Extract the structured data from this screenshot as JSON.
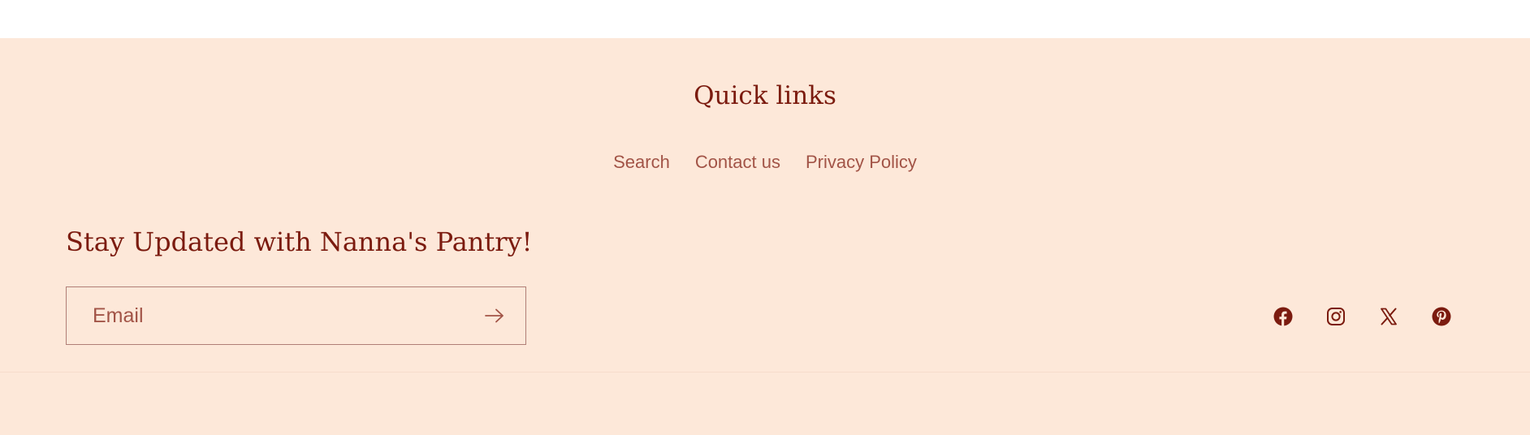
{
  "quick_links": {
    "title": "Quick links",
    "items": [
      {
        "label": "Search"
      },
      {
        "label": "Contact us"
      },
      {
        "label": "Privacy Policy"
      }
    ]
  },
  "newsletter": {
    "title": "Stay Updated with Nanna's Pantry!",
    "email_placeholder": "Email",
    "email_value": "",
    "submit_icon": "arrow-right-icon"
  },
  "socials": [
    {
      "name": "facebook",
      "icon": "facebook-icon"
    },
    {
      "name": "instagram",
      "icon": "instagram-icon"
    },
    {
      "name": "x",
      "icon": "x-icon"
    },
    {
      "name": "pinterest",
      "icon": "pinterest-icon"
    }
  ],
  "colors": {
    "background": "#fde8d9",
    "heading": "#7b1b0f",
    "link": "#a25447",
    "border": "#b07e76"
  }
}
